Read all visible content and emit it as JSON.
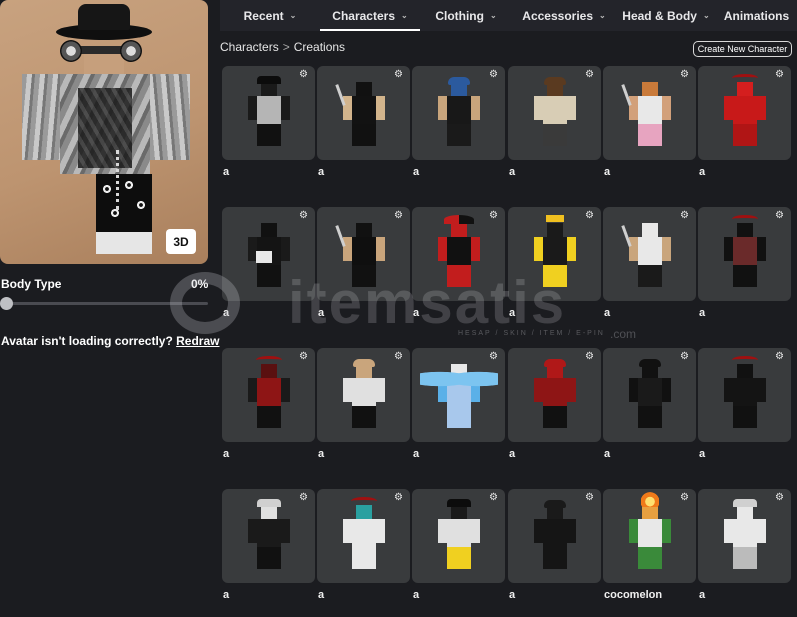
{
  "avatar": {
    "view_button": "3D"
  },
  "body_type": {
    "label": "Body Type",
    "value": "0%",
    "fraction": 0
  },
  "loading_notice": {
    "text": "Avatar isn't loading correctly? ",
    "link": "Redraw"
  },
  "tabs": [
    {
      "label": "Recent",
      "active": false
    },
    {
      "label": "Characters",
      "active": true
    },
    {
      "label": "Clothing",
      "active": false
    },
    {
      "label": "Accessories",
      "active": false
    },
    {
      "label": "Head & Body",
      "active": false
    },
    {
      "label": "Animations",
      "active": false
    }
  ],
  "breadcrumb": {
    "parent": "Characters",
    "current": "Creations",
    "separator": ">"
  },
  "create_button": "Create New Character",
  "watermark": {
    "text": "itemsatis",
    "subtext": "HESAP / SKIN / ITEM / E-PIN",
    "suffix": ".com"
  },
  "characters": [
    {
      "name": "a",
      "head": "#1a1a1a",
      "torso": "#b5b5b5",
      "arms": "#1a1a1a",
      "legs": "#111111",
      "acc": "hat"
    },
    {
      "name": "a",
      "head": "#111111",
      "torso": "#121212",
      "arms": "#d2b48c",
      "legs": "#111111",
      "acc": "knife"
    },
    {
      "name": "a",
      "head": "#2b5a9e",
      "torso": "#181818",
      "arms": "#c9a57c",
      "legs": "#1a1a1a",
      "acc": "hair"
    },
    {
      "name": "a",
      "head": "#5a3a20",
      "torso": "#d8cdb5",
      "arms": "#d8cdb5",
      "legs": "#3a3a3a",
      "acc": "hair"
    },
    {
      "name": "a",
      "head": "#c97a3a",
      "torso": "#e8e8e8",
      "arms": "#d2a07a",
      "legs": "#e7a4c0",
      "acc": "knife"
    },
    {
      "name": "a",
      "head": "#d41e1e",
      "torso": "#c81919",
      "arms": "#c81919",
      "legs": "#b01515",
      "acc": "horns"
    },
    {
      "name": "a",
      "head": "#111111",
      "torso": "#141414",
      "arms": "#1a1a1a",
      "legs": "#111111",
      "acc": "sign"
    },
    {
      "name": "a",
      "head": "#111111",
      "torso": "#0f0f0f",
      "arms": "#c9a57c",
      "legs": "#111111",
      "acc": "knife"
    },
    {
      "name": "a",
      "head": "#c21d1d",
      "torso": "#111111",
      "arms": "#c21d1d",
      "legs": "#c21d1d",
      "acc": "jester"
    },
    {
      "name": "a",
      "head": "#1a1a1a",
      "torso": "#1a1a1a",
      "arms": "#f0d020",
      "legs": "#f0d020",
      "acc": "crown"
    },
    {
      "name": "a",
      "head": "#e8e8e8",
      "torso": "#e8e8e8",
      "arms": "#c9a57c",
      "legs": "#1a1a1a",
      "acc": "knife"
    },
    {
      "name": "a",
      "head": "#111111",
      "torso": "#6a2a2a",
      "arms": "#111111",
      "legs": "#111111",
      "acc": "horns"
    },
    {
      "name": "a",
      "head": "#5a1010",
      "torso": "#8e1515",
      "arms": "#1a1a1a",
      "legs": "#111111",
      "acc": "horns"
    },
    {
      "name": "a",
      "head": "#c9a57c",
      "torso": "#e0e0e0",
      "arms": "#e0e0e0",
      "legs": "#111111",
      "acc": "hair"
    },
    {
      "name": "a",
      "head": "#e8e8e8",
      "torso": "#a8c8ec",
      "arms": "#5ab0e8",
      "legs": "#a8c8ec",
      "acc": "wings"
    },
    {
      "name": "a",
      "head": "#b01818",
      "torso": "#8e1515",
      "arms": "#8e1515",
      "legs": "#111111",
      "acc": "hair"
    },
    {
      "name": "a",
      "head": "#111111",
      "torso": "#1a1a1a",
      "arms": "#111111",
      "legs": "#111111",
      "acc": "hair"
    },
    {
      "name": "a",
      "head": "#111111",
      "torso": "#141414",
      "arms": "#141414",
      "legs": "#111111",
      "acc": "horns"
    },
    {
      "name": "a",
      "head": "#e0e0e0",
      "torso": "#1a1a1a",
      "arms": "#1a1a1a",
      "legs": "#111111",
      "acc": "hat"
    },
    {
      "name": "a",
      "head": "#2aa0a0",
      "torso": "#e8e8e8",
      "arms": "#e8e8e8",
      "legs": "#e8e8e8",
      "acc": "horns"
    },
    {
      "name": "a",
      "head": "#1a1a1a",
      "torso": "#e0e0e0",
      "arms": "#e0e0e0",
      "legs": "#f0d020",
      "acc": "hat"
    },
    {
      "name": "a",
      "head": "#1a1a1a",
      "torso": "#151515",
      "arms": "#151515",
      "legs": "#151515",
      "acc": "hair"
    },
    {
      "name": "cocomelon",
      "head": "#e8a040",
      "torso": "#e8e8e8",
      "arms": "#3a8a3a",
      "legs": "#3a8a3a",
      "acc": "flame"
    },
    {
      "name": "a",
      "head": "#e8e8e8",
      "torso": "#e8e8e8",
      "arms": "#e8e8e8",
      "legs": "#bbbbbb",
      "acc": "hat"
    }
  ]
}
